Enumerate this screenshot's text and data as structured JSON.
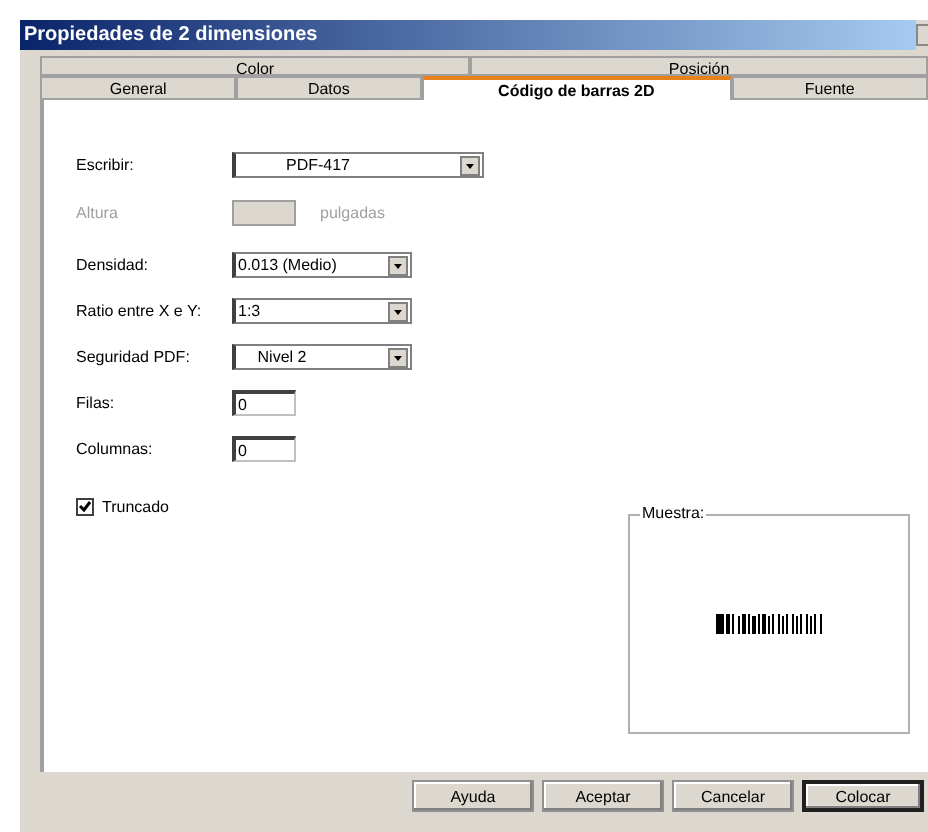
{
  "window": {
    "title": "Propiedades de 2 dimensiones"
  },
  "tab_rows": [
    [
      {
        "label": "Color",
        "selected": false
      },
      {
        "label": "Posición",
        "selected": false
      }
    ],
    [
      {
        "label": "General",
        "selected": false
      },
      {
        "label": "Datos",
        "selected": false
      },
      {
        "label": "Código de barras 2D",
        "selected": true
      },
      {
        "label": "Fuente",
        "selected": false
      }
    ]
  ],
  "fields": [
    {
      "kind": "select",
      "label": "Escribir:",
      "value": "PDF-417",
      "disabled": false
    },
    {
      "kind": "input",
      "label": "Altura",
      "unit": "pulgadas",
      "disabled": true
    },
    {
      "kind": "select",
      "label": "Densidad:",
      "value": "0.013 (Medio)",
      "disabled": false
    },
    {
      "kind": "select",
      "label": "Ratio entre X e Y:",
      "value": "1:3",
      "disabled": false
    },
    {
      "kind": "select",
      "label": "Seguridad PDF:",
      "value": "Nivel 2",
      "disabled": false
    },
    {
      "kind": "input",
      "label": "Filas:",
      "value": "0",
      "disabled": false
    },
    {
      "kind": "input",
      "label": "Columnas:",
      "value": "0",
      "disabled": false
    }
  ],
  "truncated": {
    "label": "Truncado",
    "checked": true
  },
  "sample": {
    "legend": "Muestra:"
  },
  "buttons": [
    {
      "label": "Ayuda",
      "default": false
    },
    {
      "label": "Aceptar",
      "default": false
    },
    {
      "label": "Cancelar",
      "default": false
    },
    {
      "label": "Colocar",
      "default": true
    }
  ]
}
